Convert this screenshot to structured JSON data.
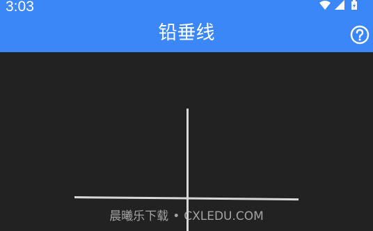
{
  "status_bar": {
    "time": "3:03",
    "icons": [
      "wifi-icon",
      "cellular-signal-icon",
      "battery-charging-icon"
    ]
  },
  "app_bar": {
    "title": "铅垂线",
    "help_icon": "help-circle-icon",
    "background": "#3b87f8"
  },
  "canvas": {
    "background": "#222222",
    "line_color": "#d9d9d9"
  },
  "watermark": {
    "text_cn": "晨曦乐下载",
    "separator": "•",
    "text_en": "CXLEDU.COM"
  }
}
